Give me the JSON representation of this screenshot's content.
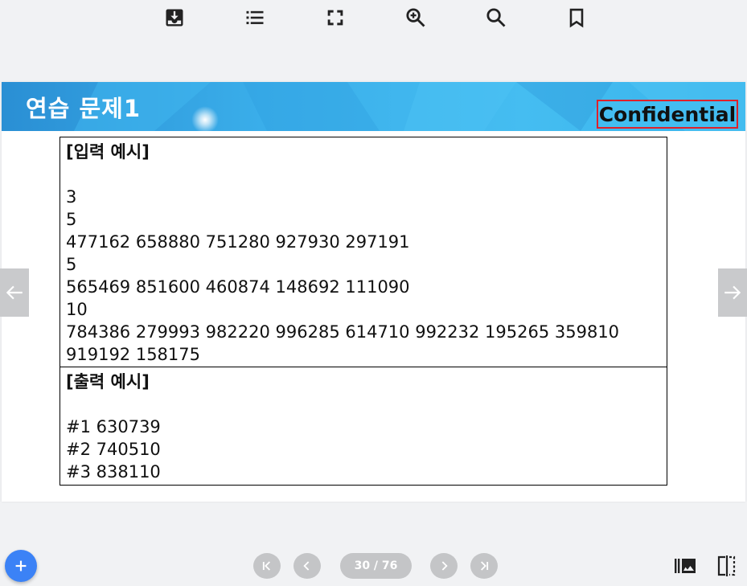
{
  "toolbar": {
    "icons": [
      "download-icon",
      "list-icon",
      "fullscreen-icon",
      "zoom-in-icon",
      "search-icon",
      "bookmark-icon"
    ]
  },
  "slide": {
    "title": "연습 문제1",
    "confidential_label": "Confidential",
    "input_box": {
      "heading": "[입력 예시]",
      "lines": [
        "3",
        "5",
        "477162 658880 751280 927930 297191",
        "5",
        "565469 851600 460874 148692 111090",
        "10",
        "784386 279993 982220 996285 614710 992232 195265 359810",
        "919192 158175"
      ]
    },
    "output_box": {
      "heading": "[출력 예시]",
      "lines": [
        "#1 630739",
        "#2 740510",
        "#3 838110"
      ]
    }
  },
  "navigation": {
    "page_indicator": "30 / 76",
    "current_page": 30,
    "total_pages": 76
  },
  "colors": {
    "banner": "#3aaeea",
    "confidential_border": "#e0202a",
    "fab": "#3b82f6",
    "nav_buttons": "#c4c5c7"
  }
}
